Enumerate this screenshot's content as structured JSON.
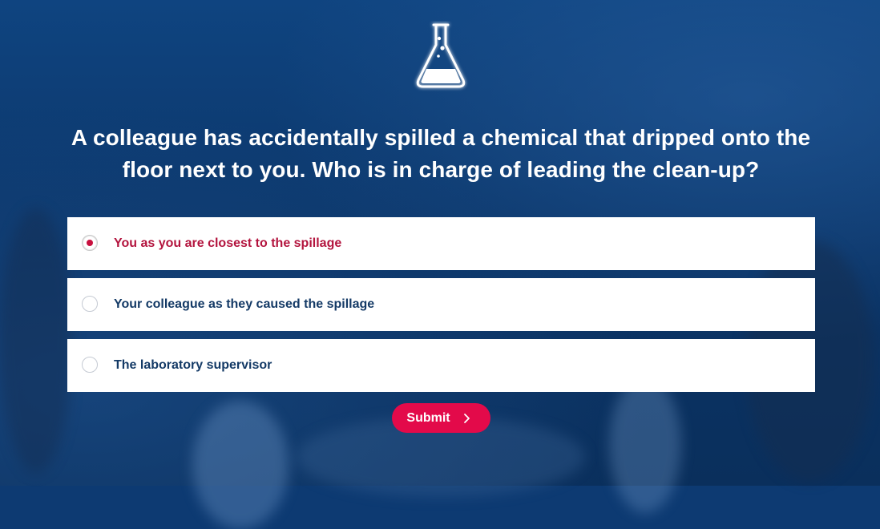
{
  "question": "A colleague has accidentally spilled a chemical that dripped onto the floor next to you. Who is in charge of leading the clean-up?",
  "options": [
    {
      "label": "You as you are closest to the spillage",
      "selected": true
    },
    {
      "label": "Your colleague as they caused the spillage",
      "selected": false
    },
    {
      "label": "The laboratory supervisor",
      "selected": false
    }
  ],
  "submit_label": "Submit",
  "icons": {
    "header": "flask-icon",
    "submit": "chevron-right-icon"
  },
  "colors": {
    "accent": "#e30a4a",
    "selected_text": "#b3143e",
    "option_text": "#143a66",
    "background": "#0d3a72"
  }
}
